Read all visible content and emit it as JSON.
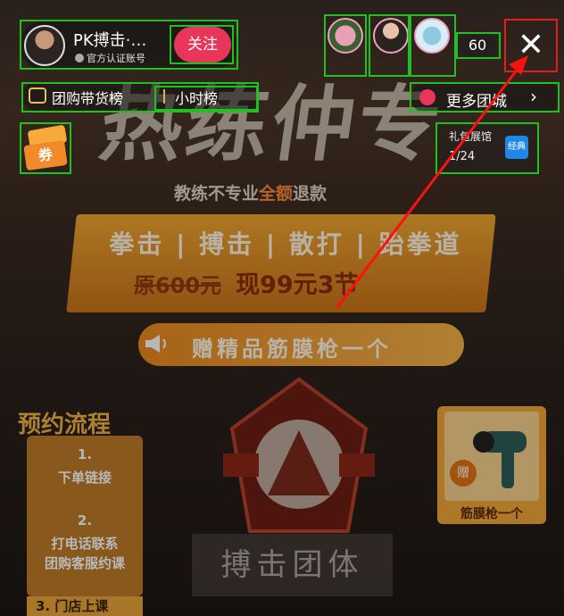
{
  "poster": {
    "headline": "热练仲专",
    "subline_pre": "教练不专业",
    "subline_highlight": "全额",
    "subline_post": "退款",
    "banner_line1": "拳击 | 搏击 | 散打 | 跆拳道",
    "price_old": "原600元",
    "price_new": "现99元3节",
    "gift": "赠精品筋膜枪一个",
    "flow_title": "预约流程",
    "steps": [
      "1.",
      "下单链接",
      "2.",
      "打电话联系",
      "团购客服约课",
      "3. 门店上课"
    ],
    "signage": "搏击团体",
    "gun_caption": "筋膜枪一个",
    "gun_badge": "赠"
  },
  "host": {
    "name": "PK搏击·…",
    "badge": "官方认证账号",
    "follow_label": "关注"
  },
  "viewers": {
    "count": "60"
  },
  "close_label": "✕",
  "rank": {
    "group_label": "团购带货榜",
    "hour_label": "小时榜"
  },
  "mall": {
    "label": "更多团城",
    "chevron": "›"
  },
  "coupon_label": "券",
  "store": {
    "title": "礼包展馆",
    "count": "1/24",
    "tag": "经典"
  },
  "colors": {
    "follow": "#e7365a",
    "annotation_box": "#20c020",
    "highlight_box": "#e02020",
    "arrow": "#ff1010"
  }
}
